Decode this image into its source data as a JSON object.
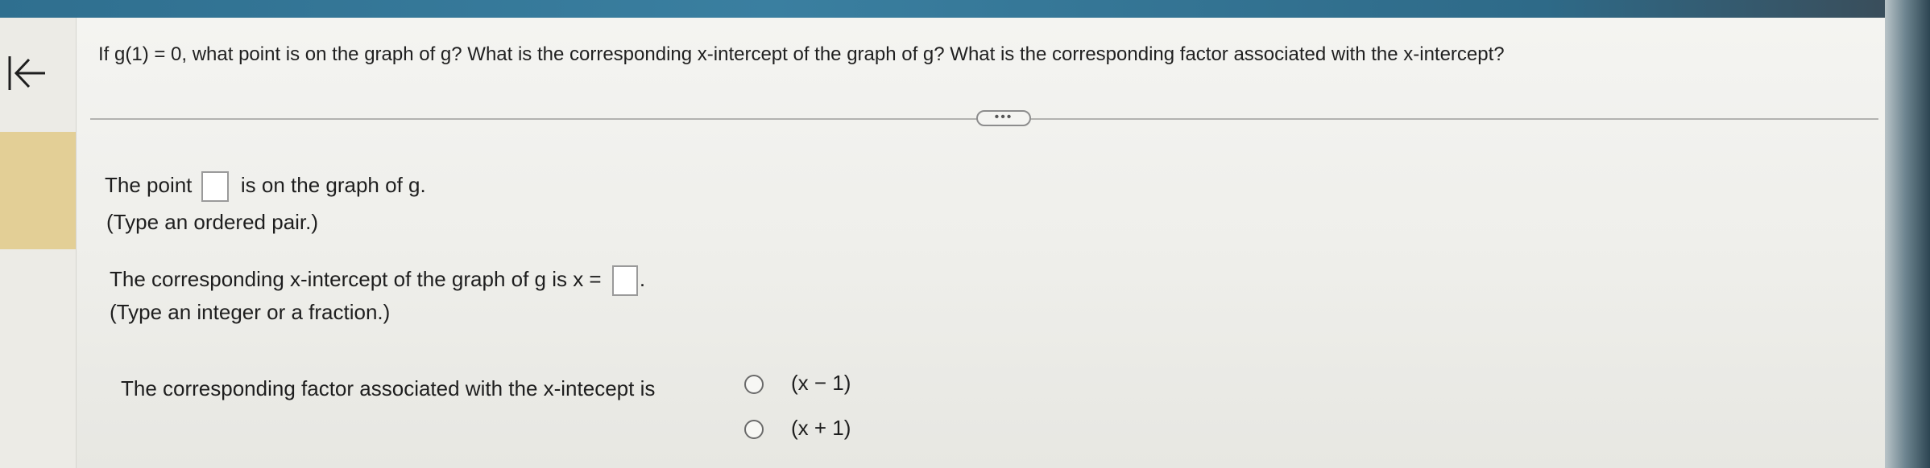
{
  "question": {
    "text": "If g(1) = 0, what point is on the graph of g? What is the corresponding x-intercept of the graph of g?  What is the corresponding factor associated with the x-intercept?"
  },
  "toolbar": {
    "back_icon": "arrow-left-to-bar-icon",
    "more_label": "•••"
  },
  "part1": {
    "prefix": "The point",
    "suffix": "is on the graph of g.",
    "hint": "(Type an ordered pair.)",
    "value": ""
  },
  "part2": {
    "prefix": "The corresponding x-intercept of the graph of g is x =",
    "suffix": ".",
    "hint": "(Type an integer or a fraction.)",
    "value": ""
  },
  "part3": {
    "prompt": "The corresponding factor associated with the x-intecept is",
    "options": [
      {
        "label": "(x − 1)",
        "selected": false
      },
      {
        "label": "(x + 1)",
        "selected": false
      }
    ]
  },
  "colors": {
    "highlight_rail": "#e3cf96",
    "top_band": "#2f6f8f"
  }
}
